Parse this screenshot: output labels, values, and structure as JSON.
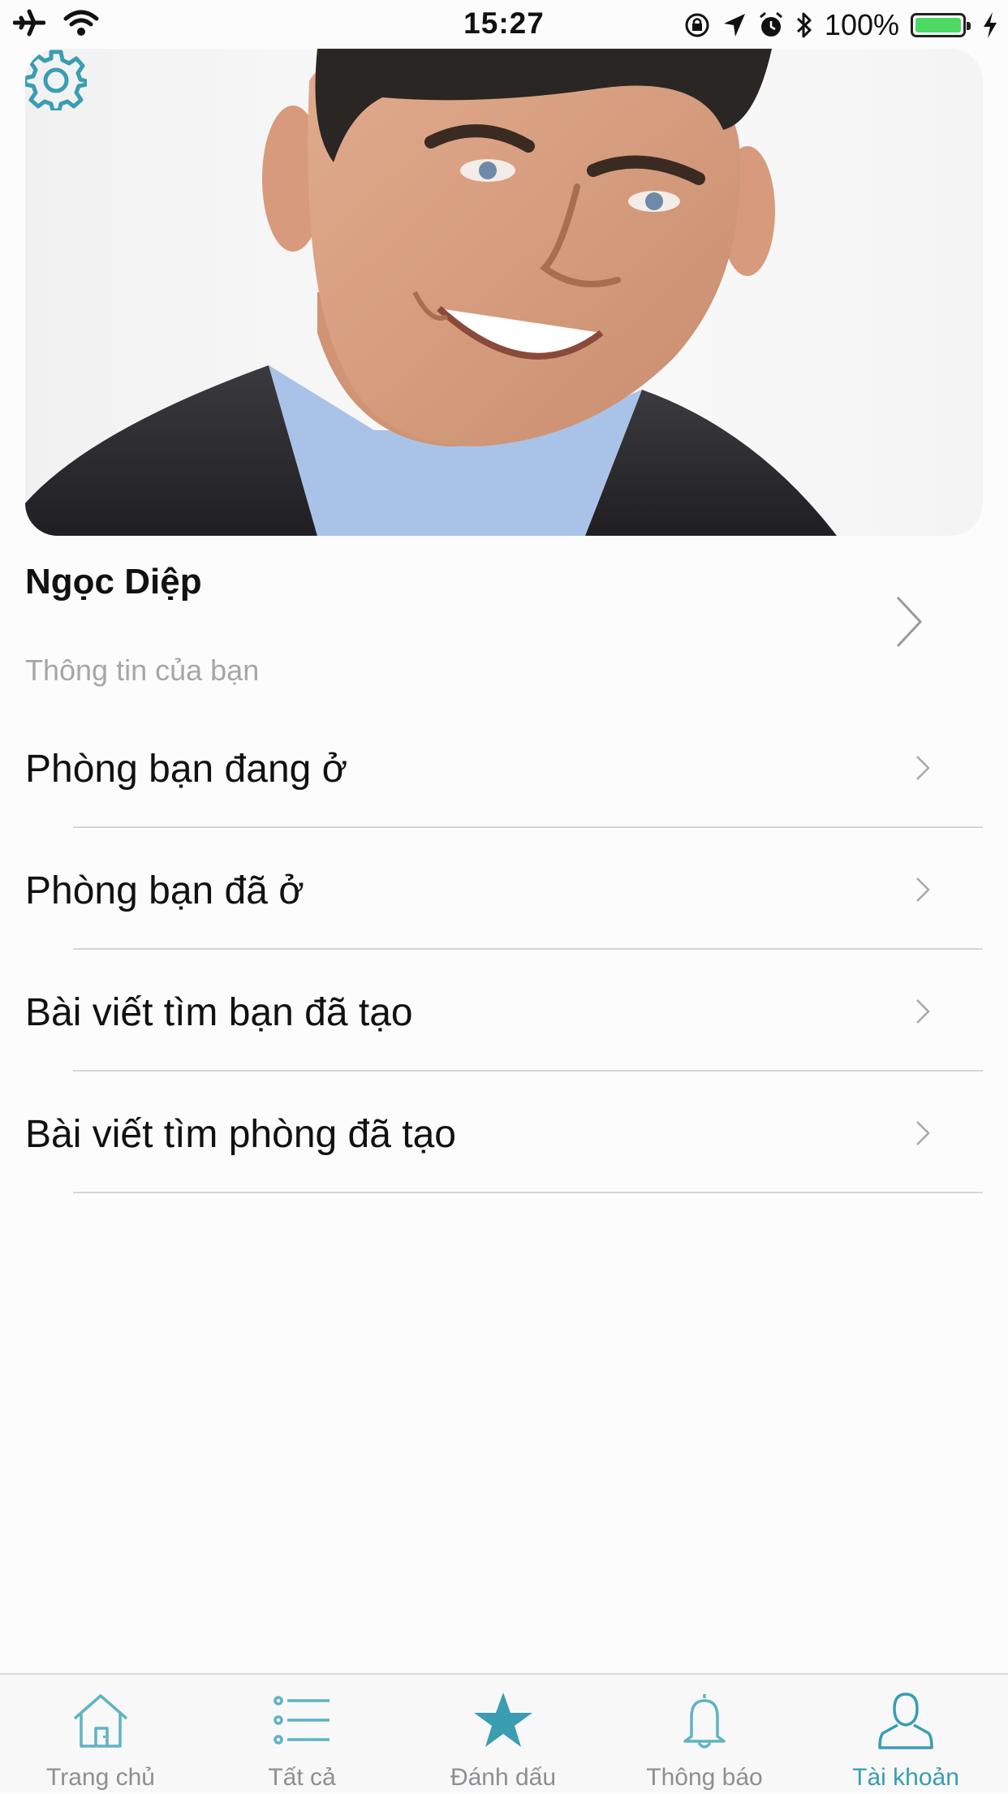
{
  "status_bar": {
    "time": "15:27",
    "battery_percent": "100%",
    "battery_level": 1.0
  },
  "colors": {
    "accent": "#3a9db1",
    "inactive": "#8e8e93",
    "divider": "#d6d6d6"
  },
  "header": {
    "settings_icon": "gear-icon"
  },
  "profile": {
    "name": "Ngọc Diệp",
    "subtitle": "Thông tin của bạn"
  },
  "menu": {
    "items": [
      {
        "label": "Phòng bạn đang ở"
      },
      {
        "label": "Phòng bạn đã ở"
      },
      {
        "label": "Bài viết tìm bạn đã tạo"
      },
      {
        "label": "Bài viết tìm phòng đã tạo"
      }
    ]
  },
  "tabbar": {
    "items": [
      {
        "label": "Trang chủ",
        "icon": "home-icon"
      },
      {
        "label": "Tất cả",
        "icon": "list-icon"
      },
      {
        "label": "Đánh dấu",
        "icon": "star-icon"
      },
      {
        "label": "Thông báo",
        "icon": "bell-icon"
      },
      {
        "label": "Tài khoản",
        "icon": "person-icon",
        "active": true
      }
    ]
  }
}
